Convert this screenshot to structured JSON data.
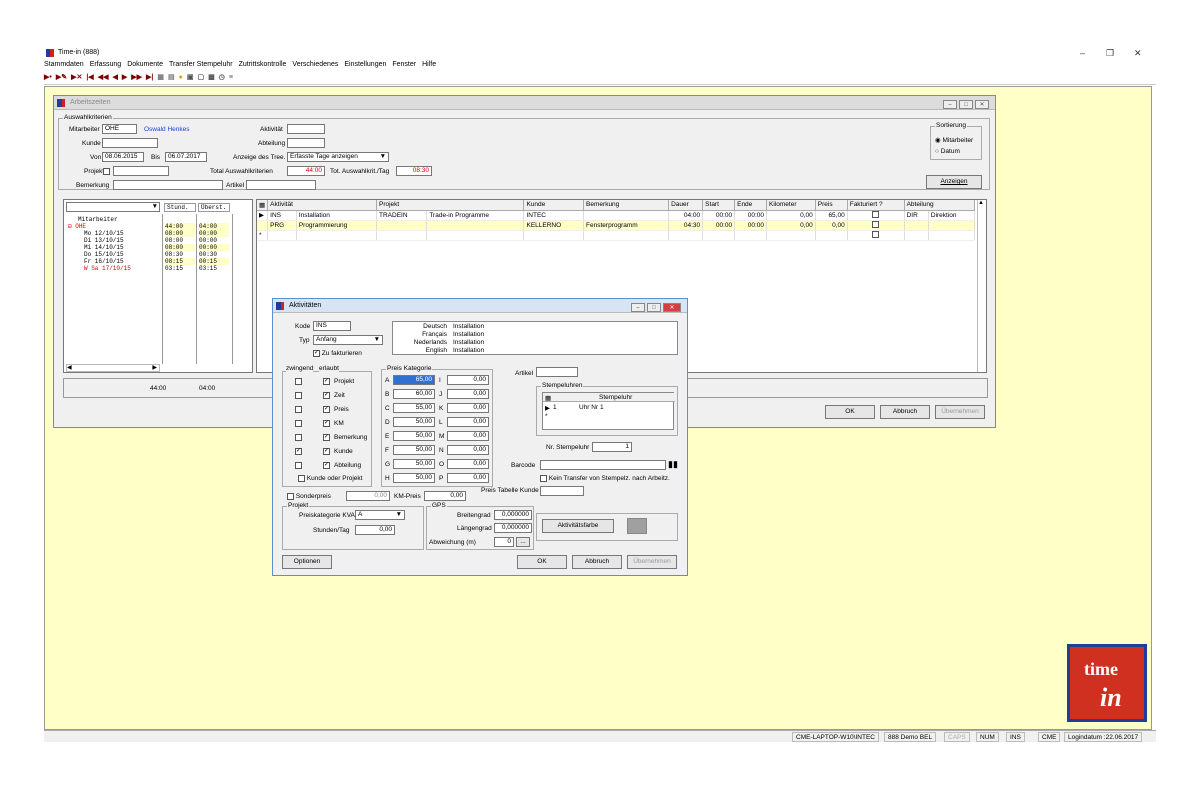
{
  "app": {
    "title": "Time-in (888)",
    "menu": [
      "Stammdaten",
      "Erfassung",
      "Dokumente",
      "Transfer Stempeluhr",
      "Zutrittskontrolle",
      "Verschiedenes",
      "Einstellungen",
      "Fenster",
      "Hilfe"
    ]
  },
  "arbeitszeiten": {
    "title": "Arbeitszeiten",
    "criteria_label": "Auswahlkriterien",
    "mitarbeiter_label": "Mitarbeiter",
    "mitarbeiter_code": "OHE",
    "mitarbeiter_name": "Oswald Henkes",
    "kunde_label": "Kunde",
    "kunde_value": "",
    "von_label": "Von",
    "von_value": "08.06.2015",
    "bis_label": "Bis",
    "bis_value": "06.07.2017",
    "projekt_label": "Projekt",
    "bemerkung_label": "Bemerkung",
    "aktivitaet_label": "Aktivität",
    "abteilung_label": "Abteilung",
    "anzeige_label": "Anzeige des Tree.",
    "anzeige_value": "Erfasste Tage anzeigen",
    "total_label": "Total Auswahlkriterien",
    "total_value": "44:00",
    "tot_tag_label": "Tot. Auswahlkrit./Tag",
    "tot_tag_value": "08:30",
    "artikel_label": "Artikel",
    "sortierung_label": "Sortierung",
    "sort_mitarbeiter": "Mitarbeiter",
    "sort_datum": "Datum",
    "anzeigen_button": "Anzeigen",
    "tree_header": {
      "stund": "Stund.",
      "uberst": "Überst."
    },
    "tree_root": "Mitarbeiter",
    "tree_emp": "OHE",
    "tree_rows": [
      {
        "day": "Mo 12/10/15",
        "stund": "08:00",
        "uberst": "00:00"
      },
      {
        "day": "Di 13/10/15",
        "stund": "08:00",
        "uberst": "00:00"
      },
      {
        "day": "Mi 14/10/15",
        "stund": "08:00",
        "uberst": "00:00"
      },
      {
        "day": "Do 15/10/15",
        "stund": "08:30",
        "uberst": "00:30"
      },
      {
        "day": "Fr 16/10/15",
        "stund": "08:15",
        "uberst": "00:15"
      },
      {
        "day": "Sa 17/10/15",
        "stund": "03:15",
        "uberst": "03:15"
      }
    ],
    "emp_stund": "44:00",
    "emp_uberst": "04:00",
    "sum_stund": "44:00",
    "sum_uberst": "04:00",
    "grid_headers": [
      "Aktivität",
      "Projekt",
      "Kunde",
      "Bemerkung",
      "Dauer",
      "Start",
      "Ende",
      "Kilometer",
      "Preis",
      "Fakturiert ?",
      "Abteilung"
    ],
    "grid_rows": [
      {
        "akt": "INS",
        "akt_desc": "Installation",
        "proj": "TRADEIN",
        "proj_desc": "Trade-in Programme",
        "kunde": "INTEC",
        "bem": "",
        "dauer": "04:00",
        "start": "00:00",
        "ende": "00:00",
        "km": "0,00",
        "preis": "65,00",
        "abt": "DIR",
        "abt_desc": "Direktion"
      },
      {
        "akt": "PRG",
        "akt_desc": "Programmierung",
        "proj": "",
        "proj_desc": "",
        "kunde": "KELLERNO",
        "bem": "Fensterprogramm",
        "dauer": "04:30",
        "start": "00:00",
        "ende": "00:00",
        "km": "0,00",
        "preis": "0,00",
        "abt": "",
        "abt_desc": ""
      }
    ],
    "ok": "OK",
    "abbruch": "Abbruch",
    "ubernehmen": "Übernehmen"
  },
  "aktivitaeten": {
    "title": "Aktivitäten",
    "kode_label": "Kode",
    "kode_value": "INS",
    "typ_label": "Typ",
    "typ_value": "Anfang",
    "zu_fakt": "Zu fakturieren",
    "lang": [
      {
        "l": "Deutsch",
        "v": "Installation"
      },
      {
        "l": "Français",
        "v": "Installation"
      },
      {
        "l": "Nederlands",
        "v": "Installation"
      },
      {
        "l": "English",
        "v": "Installation"
      }
    ],
    "zwingend": "zwingend",
    "erlaubt": "erlaubt",
    "checks": [
      {
        "label": "Projekt",
        "zw": false,
        "er": true
      },
      {
        "label": "Zeit",
        "zw": false,
        "er": true
      },
      {
        "label": "Preis",
        "zw": false,
        "er": true
      },
      {
        "label": "KM",
        "zw": false,
        "er": true
      },
      {
        "label": "Bemerkung",
        "zw": false,
        "er": true
      },
      {
        "label": "Kunde",
        "zw": true,
        "er": true
      },
      {
        "label": "Abteilung",
        "zw": false,
        "er": true
      }
    ],
    "kunde_oder_projekt": "Kunde oder Projekt",
    "preis_kategorie": "Preis Kategorie",
    "preise_left": [
      {
        "k": "A",
        "v": "65,00"
      },
      {
        "k": "B",
        "v": "60,00"
      },
      {
        "k": "C",
        "v": "55,00"
      },
      {
        "k": "D",
        "v": "50,00"
      },
      {
        "k": "E",
        "v": "50,00"
      },
      {
        "k": "F",
        "v": "50,00"
      },
      {
        "k": "G",
        "v": "50,00"
      },
      {
        "k": "H",
        "v": "50,00"
      }
    ],
    "preise_right": [
      {
        "k": "I",
        "v": "0,00"
      },
      {
        "k": "J",
        "v": "0,00"
      },
      {
        "k": "K",
        "v": "0,00"
      },
      {
        "k": "L",
        "v": "0,00"
      },
      {
        "k": "M",
        "v": "0,00"
      },
      {
        "k": "N",
        "v": "0,00"
      },
      {
        "k": "O",
        "v": "0,00"
      },
      {
        "k": "P",
        "v": "0,00"
      }
    ],
    "artikel_label": "Artikel",
    "stempeluhren": "Stempeluhren",
    "stempeluhr_col": "Stempeluhr",
    "su_num": "1",
    "su_name": "Uhr Nr 1",
    "nr_stempeluhr_label": "Nr. Stempeluhr",
    "nr_stempeluhr_value": "1",
    "barcode_label": "Barcode",
    "kein_transfer": "Kein Transfer von Stempelz. nach Arbeitz.",
    "sonderpreis": "Sonderpreis",
    "sonderpreis_value": "0,00",
    "km_preis_label": "KM-Preis",
    "km_preis_value": "0,00",
    "preis_tabelle": "Preis Tabelle Kunde",
    "projekt_group": "Projekt",
    "preiskat_kva": "Preiskategorie KVA",
    "preiskat_value": "A",
    "stunden_tag": "Stunden/Tag",
    "stunden_tag_value": "0,00",
    "gps": "GPS",
    "breitengrad": "Breitengrad",
    "breitengrad_value": "0,000000",
    "laengengrad": "Längengrad",
    "laengengrad_value": "0,000000",
    "abweichung": "Abweichung (m)",
    "abweichung_value": "0",
    "farbe_button": "Aktivitätsfarbe",
    "optionen": "Optionen",
    "ok": "OK",
    "abbruch": "Abbruch",
    "ubernehmen": "Übernehmen"
  },
  "status": {
    "pc": "CME-LAPTOP-W10\\INTEC",
    "demo": "888 Demo BEL",
    "caps": "CAPS",
    "num": "NUM",
    "ins": "INS",
    "cme": "CME",
    "login": "Logindatum :22.06.2017"
  },
  "logo_text": "time in"
}
